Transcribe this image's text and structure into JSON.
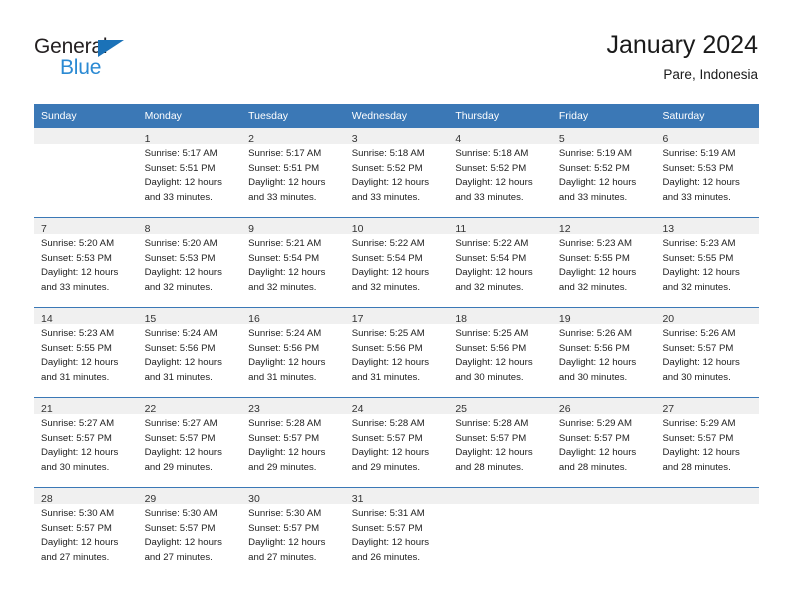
{
  "brand": {
    "name_part1": "General",
    "name_part2": "Blue",
    "triangle_color": "#1b72b8",
    "blue_color": "#2b8ad3"
  },
  "header": {
    "title": "January 2024",
    "subtitle": "Pare, Indonesia"
  },
  "calendar": {
    "header_bg": "#3b78b6",
    "daynum_bg": "#f0f0f0",
    "weekdays": [
      "Sunday",
      "Monday",
      "Tuesday",
      "Wednesday",
      "Thursday",
      "Friday",
      "Saturday"
    ],
    "weeks": [
      [
        {
          "day": "",
          "lines": []
        },
        {
          "day": "1",
          "lines": [
            "Sunrise: 5:17 AM",
            "Sunset: 5:51 PM",
            "Daylight: 12 hours",
            "and 33 minutes."
          ]
        },
        {
          "day": "2",
          "lines": [
            "Sunrise: 5:17 AM",
            "Sunset: 5:51 PM",
            "Daylight: 12 hours",
            "and 33 minutes."
          ]
        },
        {
          "day": "3",
          "lines": [
            "Sunrise: 5:18 AM",
            "Sunset: 5:52 PM",
            "Daylight: 12 hours",
            "and 33 minutes."
          ]
        },
        {
          "day": "4",
          "lines": [
            "Sunrise: 5:18 AM",
            "Sunset: 5:52 PM",
            "Daylight: 12 hours",
            "and 33 minutes."
          ]
        },
        {
          "day": "5",
          "lines": [
            "Sunrise: 5:19 AM",
            "Sunset: 5:52 PM",
            "Daylight: 12 hours",
            "and 33 minutes."
          ]
        },
        {
          "day": "6",
          "lines": [
            "Sunrise: 5:19 AM",
            "Sunset: 5:53 PM",
            "Daylight: 12 hours",
            "and 33 minutes."
          ]
        }
      ],
      [
        {
          "day": "7",
          "lines": [
            "Sunrise: 5:20 AM",
            "Sunset: 5:53 PM",
            "Daylight: 12 hours",
            "and 33 minutes."
          ]
        },
        {
          "day": "8",
          "lines": [
            "Sunrise: 5:20 AM",
            "Sunset: 5:53 PM",
            "Daylight: 12 hours",
            "and 32 minutes."
          ]
        },
        {
          "day": "9",
          "lines": [
            "Sunrise: 5:21 AM",
            "Sunset: 5:54 PM",
            "Daylight: 12 hours",
            "and 32 minutes."
          ]
        },
        {
          "day": "10",
          "lines": [
            "Sunrise: 5:22 AM",
            "Sunset: 5:54 PM",
            "Daylight: 12 hours",
            "and 32 minutes."
          ]
        },
        {
          "day": "11",
          "lines": [
            "Sunrise: 5:22 AM",
            "Sunset: 5:54 PM",
            "Daylight: 12 hours",
            "and 32 minutes."
          ]
        },
        {
          "day": "12",
          "lines": [
            "Sunrise: 5:23 AM",
            "Sunset: 5:55 PM",
            "Daylight: 12 hours",
            "and 32 minutes."
          ]
        },
        {
          "day": "13",
          "lines": [
            "Sunrise: 5:23 AM",
            "Sunset: 5:55 PM",
            "Daylight: 12 hours",
            "and 32 minutes."
          ]
        }
      ],
      [
        {
          "day": "14",
          "lines": [
            "Sunrise: 5:23 AM",
            "Sunset: 5:55 PM",
            "Daylight: 12 hours",
            "and 31 minutes."
          ]
        },
        {
          "day": "15",
          "lines": [
            "Sunrise: 5:24 AM",
            "Sunset: 5:56 PM",
            "Daylight: 12 hours",
            "and 31 minutes."
          ]
        },
        {
          "day": "16",
          "lines": [
            "Sunrise: 5:24 AM",
            "Sunset: 5:56 PM",
            "Daylight: 12 hours",
            "and 31 minutes."
          ]
        },
        {
          "day": "17",
          "lines": [
            "Sunrise: 5:25 AM",
            "Sunset: 5:56 PM",
            "Daylight: 12 hours",
            "and 31 minutes."
          ]
        },
        {
          "day": "18",
          "lines": [
            "Sunrise: 5:25 AM",
            "Sunset: 5:56 PM",
            "Daylight: 12 hours",
            "and 30 minutes."
          ]
        },
        {
          "day": "19",
          "lines": [
            "Sunrise: 5:26 AM",
            "Sunset: 5:56 PM",
            "Daylight: 12 hours",
            "and 30 minutes."
          ]
        },
        {
          "day": "20",
          "lines": [
            "Sunrise: 5:26 AM",
            "Sunset: 5:57 PM",
            "Daylight: 12 hours",
            "and 30 minutes."
          ]
        }
      ],
      [
        {
          "day": "21",
          "lines": [
            "Sunrise: 5:27 AM",
            "Sunset: 5:57 PM",
            "Daylight: 12 hours",
            "and 30 minutes."
          ]
        },
        {
          "day": "22",
          "lines": [
            "Sunrise: 5:27 AM",
            "Sunset: 5:57 PM",
            "Daylight: 12 hours",
            "and 29 minutes."
          ]
        },
        {
          "day": "23",
          "lines": [
            "Sunrise: 5:28 AM",
            "Sunset: 5:57 PM",
            "Daylight: 12 hours",
            "and 29 minutes."
          ]
        },
        {
          "day": "24",
          "lines": [
            "Sunrise: 5:28 AM",
            "Sunset: 5:57 PM",
            "Daylight: 12 hours",
            "and 29 minutes."
          ]
        },
        {
          "day": "25",
          "lines": [
            "Sunrise: 5:28 AM",
            "Sunset: 5:57 PM",
            "Daylight: 12 hours",
            "and 28 minutes."
          ]
        },
        {
          "day": "26",
          "lines": [
            "Sunrise: 5:29 AM",
            "Sunset: 5:57 PM",
            "Daylight: 12 hours",
            "and 28 minutes."
          ]
        },
        {
          "day": "27",
          "lines": [
            "Sunrise: 5:29 AM",
            "Sunset: 5:57 PM",
            "Daylight: 12 hours",
            "and 28 minutes."
          ]
        }
      ],
      [
        {
          "day": "28",
          "lines": [
            "Sunrise: 5:30 AM",
            "Sunset: 5:57 PM",
            "Daylight: 12 hours",
            "and 27 minutes."
          ]
        },
        {
          "day": "29",
          "lines": [
            "Sunrise: 5:30 AM",
            "Sunset: 5:57 PM",
            "Daylight: 12 hours",
            "and 27 minutes."
          ]
        },
        {
          "day": "30",
          "lines": [
            "Sunrise: 5:30 AM",
            "Sunset: 5:57 PM",
            "Daylight: 12 hours",
            "and 27 minutes."
          ]
        },
        {
          "day": "31",
          "lines": [
            "Sunrise: 5:31 AM",
            "Sunset: 5:57 PM",
            "Daylight: 12 hours",
            "and 26 minutes."
          ]
        },
        {
          "day": "",
          "lines": []
        },
        {
          "day": "",
          "lines": []
        },
        {
          "day": "",
          "lines": []
        }
      ]
    ]
  }
}
